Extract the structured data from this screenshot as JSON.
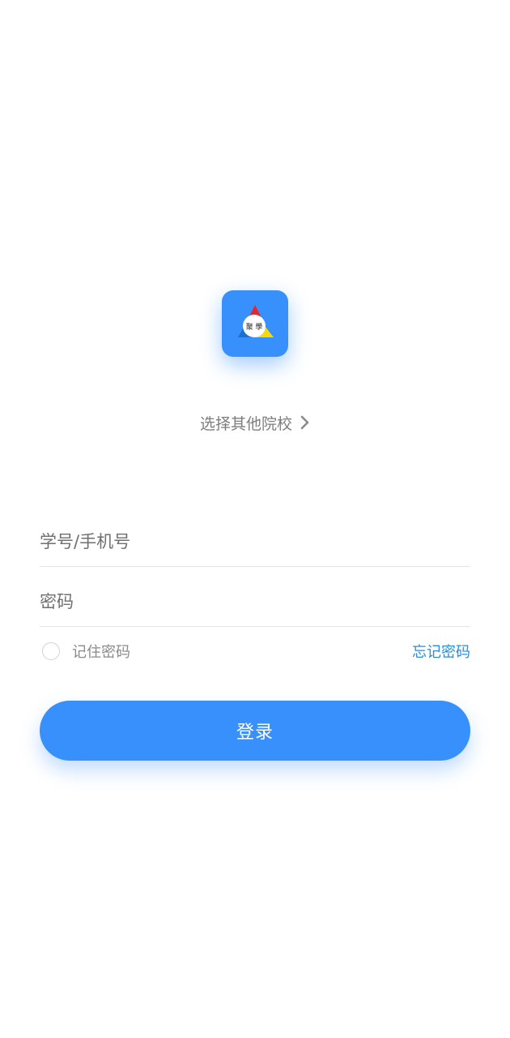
{
  "app": {
    "icon_name": "school-logo-icon",
    "logo_text": "聚 學"
  },
  "school_select": {
    "label": "选择其他院校",
    "icon": "chevron-right-icon"
  },
  "form": {
    "account_placeholder": "学号/手机号",
    "password_placeholder": "密码",
    "remember_label": "记住密码",
    "remember_checked": false,
    "forgot_label": "忘记密码"
  },
  "login": {
    "label": "登录"
  },
  "colors": {
    "accent": "#3790fb",
    "link": "#2d8ed1",
    "logo_red": "#e8262a",
    "logo_yellow": "#f5d90a",
    "logo_blue": "#1f6fd1"
  }
}
